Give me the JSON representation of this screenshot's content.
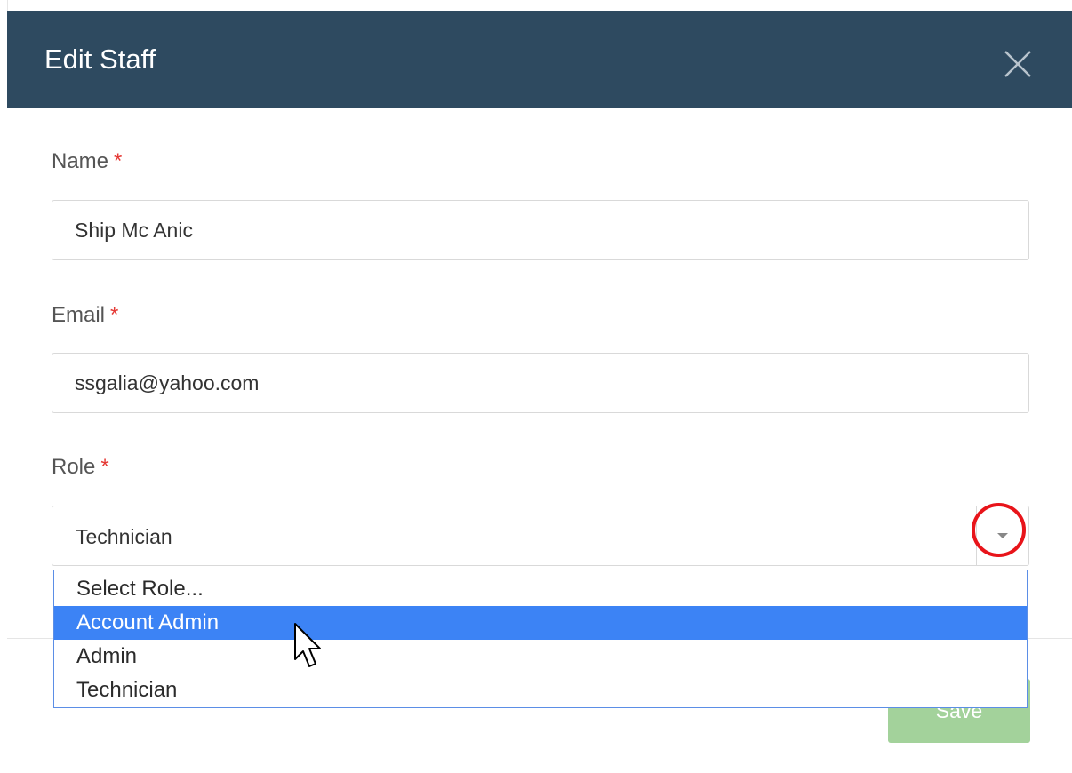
{
  "modal": {
    "title": "Edit Staff",
    "close_icon": "close-icon"
  },
  "form": {
    "name": {
      "label": "Name",
      "required_marker": "*",
      "value": "Ship Mc Anic"
    },
    "email": {
      "label": "Email",
      "required_marker": "*",
      "value": "ssgalia@yahoo.com"
    },
    "role": {
      "label": "Role",
      "required_marker": "*",
      "selected": "Technician",
      "options": [
        "Select Role...",
        "Account Admin",
        "Admin",
        "Technician"
      ],
      "highlighted_option": "Account Admin",
      "arrow_icon": "caret-down-icon"
    }
  },
  "footer": {
    "save_label": "Save"
  },
  "colors": {
    "header_bg": "#2e4a60",
    "required": "#e53935",
    "dropdown_highlight": "#3c83f5",
    "save_button": "#a3d29b",
    "annotation_ring": "#e8141a"
  }
}
